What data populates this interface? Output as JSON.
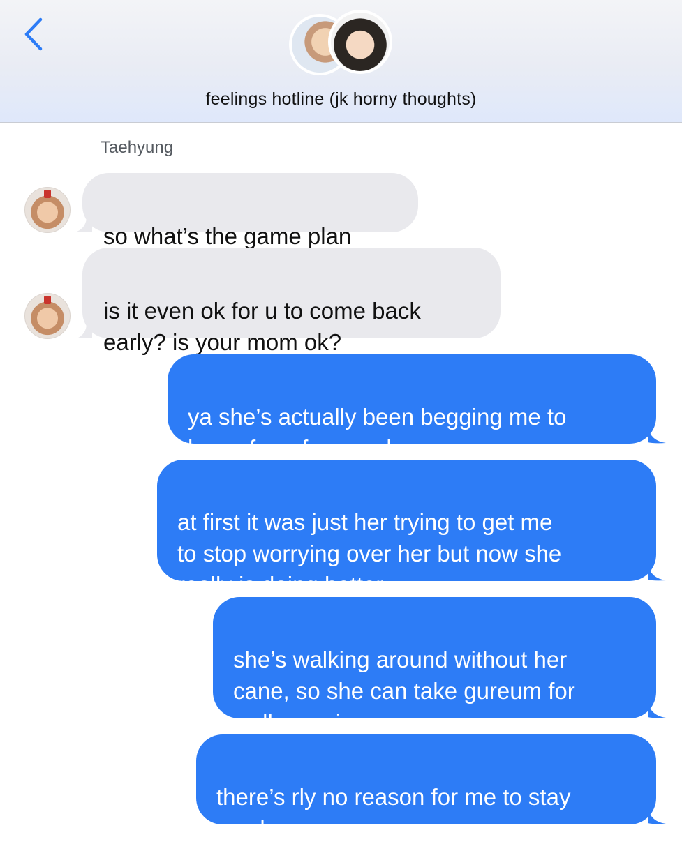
{
  "header": {
    "title": "feelings hotline (jk horny thoughts)",
    "back_icon": "chevron-left-icon",
    "accent_color": "#2d7cf6"
  },
  "conversation": {
    "sender_name": "Taehyung",
    "incoming_bubble_color": "#e9e9ed",
    "outgoing_bubble_color": "#2d7cf6",
    "messages": [
      {
        "direction": "incoming",
        "text": "so what’s the game plan"
      },
      {
        "direction": "incoming",
        "text": "is it even ok for u to come back\nearly? is your mom ok?"
      },
      {
        "direction": "outgoing",
        "text": "ya she’s actually been begging me to\nleave for a few weeks now"
      },
      {
        "direction": "outgoing",
        "text": "at first it was just her trying to get me\nto stop worrying over her but now she\nreally is doing better"
      },
      {
        "direction": "outgoing",
        "text": "she’s walking around without her\ncane, so she can take gureum for\nwalks again"
      },
      {
        "direction": "outgoing",
        "text": "there’s rly no reason for me to stay\nany longer"
      }
    ]
  }
}
